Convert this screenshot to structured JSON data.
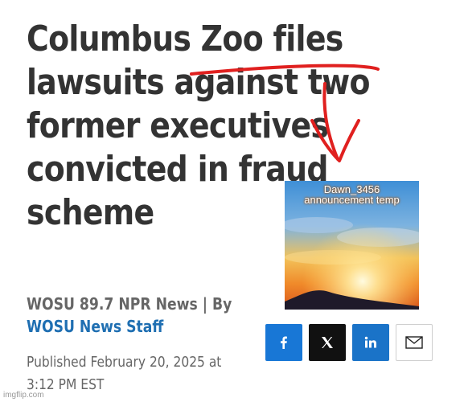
{
  "article": {
    "headline_lines": [
      "Columbus Zoo files",
      "lawsuits against two",
      "former executives",
      "convicted in fraud",
      "scheme"
    ],
    "byline": {
      "source": "WOSU 89.7 NPR News | By",
      "author": "WOSU News Staff"
    },
    "published_line1": "Published February 20, 2025 at",
    "published_line2": "3:12 PM EST"
  },
  "overlay_image": {
    "caption_line1": "Dawn_3456",
    "caption_line2": "announcement temp"
  },
  "share": {
    "buttons": [
      {
        "name": "facebook",
        "icon": "facebook-icon",
        "color": "#1877d6"
      },
      {
        "name": "x",
        "icon": "x-icon",
        "color": "#111111"
      },
      {
        "name": "linkedin",
        "icon": "linkedin-icon",
        "color": "#1a73c8"
      },
      {
        "name": "email",
        "icon": "email-icon",
        "color": "#ffffff"
      }
    ]
  },
  "annotation": {
    "color": "#e0201f"
  },
  "watermark": "imgflip.com"
}
